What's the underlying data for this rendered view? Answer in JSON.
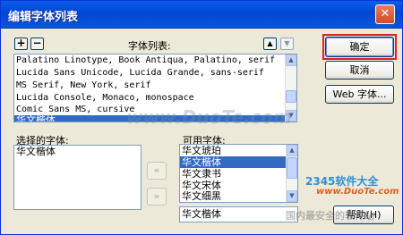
{
  "window": {
    "title": "编辑字体列表",
    "close_glyph": "✕"
  },
  "font_list": {
    "label": "字体列表:",
    "add_glyph": "+",
    "remove_glyph": "−",
    "up_glyph": "▲",
    "down_glyph": "▼",
    "items": [
      "Palatino Linotype, Book Antiqua, Palatino, serif",
      "Lucida Sans Unicode, Lucida Grande, sans-serif",
      "MS Serif, New York, serif",
      "Lucida Console, Monaco, monospace",
      "Comic Sans MS, cursive",
      "华文楷体"
    ],
    "selected_index": 5
  },
  "selected_fonts": {
    "label": "选择的字体:",
    "items": [
      "华文楷体"
    ]
  },
  "available_fonts": {
    "label": "可用字体:",
    "items": [
      "华文琥珀",
      "华文楷体",
      "华文隶书",
      "华文宋体",
      "华文细黑"
    ],
    "selected_index": 1,
    "input_value": "华文楷体"
  },
  "move_buttons": {
    "left_glyph": "«",
    "right_glyph": "»"
  },
  "buttons": {
    "ok": "确定",
    "cancel": "取消",
    "web_fonts": "Web 字体...",
    "help": "帮助(H)"
  },
  "watermarks": {
    "center": "www.DuoTe.com",
    "logo": "2345软件大全",
    "logo_url": "www.DuoTe.com",
    "bottom": "国内最安全的软件站"
  },
  "colors": {
    "accent": "#316ac5",
    "title_bar": "#0245d6",
    "focus": "#e02020"
  }
}
